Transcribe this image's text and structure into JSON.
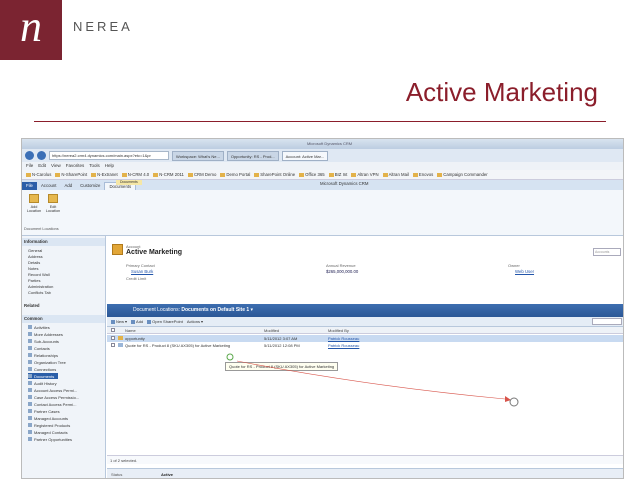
{
  "slide": {
    "logo_letter": "n",
    "brand": "NEREA",
    "title": "Active Marketing"
  },
  "browser": {
    "window_title": "Microsoft Dynamics CRM",
    "url": "https://nerea2.crm4.dynamics.com/main.aspx?etc=1&pr",
    "tabs": [
      "Workspace: What's Ne...",
      "Opportunity: RS - Prod...",
      "Account: Active Mar..."
    ],
    "menu": [
      "File",
      "Edit",
      "View",
      "Favorites",
      "Tools",
      "Help"
    ],
    "favorites": [
      "N-Carolus",
      "N-SharePoint",
      "N-Extranet",
      "N-CRM 4.0",
      "N-CRM 2011",
      "CRM Demo",
      "Demo Portal",
      "SharePoint Online",
      "Office 365",
      "BIZ Int",
      "Altran VPN",
      "Altran Mail",
      "Enovos",
      "Campaign Commander"
    ]
  },
  "ribbon": {
    "context_label": "Documents",
    "tabs": [
      "File",
      "Account",
      "Add",
      "Customize",
      "Documents"
    ],
    "crm_title": "Microsoft Dynamics CRM",
    "buttons": [
      {
        "label": "Add Location",
        "icon": "folder-add-icon"
      },
      {
        "label": "Edit Location",
        "icon": "folder-edit-icon"
      }
    ],
    "group_label": "Document Locations"
  },
  "leftnav": {
    "information_header": "Information",
    "information_items": [
      "General",
      "Address",
      "Details",
      "Notes",
      "Record Wall",
      "Parties",
      "Administration",
      "Conflicts Tab"
    ],
    "related_header": "Related",
    "common_header": "Common",
    "common_items": [
      "Activities",
      "More Addresses",
      "Sub-Accounts",
      "Contacts",
      "Relationships",
      "Organization Tree",
      "Connections",
      "Documents",
      "Audit History",
      "Account Access Permi...",
      "Case Access Permissio...",
      "Contact Access Permi...",
      "Partner Cases",
      "Managed Accounts",
      "Registered Products",
      "Managed Contacts",
      "Partner Opportunities"
    ]
  },
  "account": {
    "entity": "Account",
    "name": "Active Marketing",
    "primary_contact_label": "Primary Contact",
    "primary_contact": "Susan Burk",
    "credit_limit_label": "Credit Limit",
    "annual_revenue_label": "Annual Revenue",
    "annual_revenue": "$265,000,000.00",
    "owner_label": "Owner",
    "owner": "Web User",
    "search_placeholder": "Accounts"
  },
  "documents": {
    "bar_prefix": "Document Locations:",
    "location": "Documents on Default Site 1",
    "toolbar": [
      "New",
      "Add",
      "Open SharePoint",
      "Actions"
    ],
    "columns": [
      "Name",
      "Modified",
      "Modified By"
    ],
    "rows": [
      {
        "name": "opportunity",
        "modified": "5/11/2012 3:07 AM",
        "modified_by": "Patrick Rousseau"
      },
      {
        "name": "Quote for RS - Product 8 (SKU AX305) for Active Marketing",
        "modified": "5/11/2012 12:08 PM",
        "modified_by": "Patrick Rousseau"
      }
    ],
    "tooltip": "Quote for RS - Product 8 (SKU AX305) for Active Marketing",
    "selection_status": "1 of 2 selected."
  },
  "statusbar": {
    "label": "Status",
    "value": "Active"
  }
}
